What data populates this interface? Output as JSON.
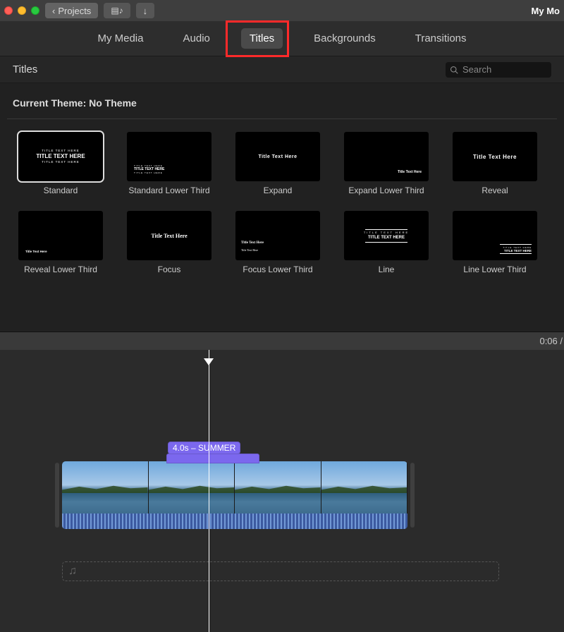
{
  "toolbar": {
    "back_label": "Projects",
    "project_title": "My Mo"
  },
  "tabs": {
    "items": [
      {
        "label": "My Media",
        "active": false
      },
      {
        "label": "Audio",
        "active": false
      },
      {
        "label": "Titles",
        "active": true
      },
      {
        "label": "Backgrounds",
        "active": false
      },
      {
        "label": "Transitions",
        "active": false
      }
    ]
  },
  "subbar": {
    "section_label": "Titles",
    "search_placeholder": "Search"
  },
  "browser": {
    "theme_heading": "Current Theme: No Theme",
    "items": [
      {
        "label": "Standard"
      },
      {
        "label": "Standard Lower Third"
      },
      {
        "label": "Expand"
      },
      {
        "label": "Expand Lower Third"
      },
      {
        "label": "Reveal"
      },
      {
        "label": "Reveal Lower Third"
      },
      {
        "label": "Focus"
      },
      {
        "label": "Focus Lower Third"
      },
      {
        "label": "Line"
      },
      {
        "label": "Line Lower Third"
      }
    ]
  },
  "timeline": {
    "playhead_time": "0:06 /",
    "title_clip_label": "4.0s – SUMMER"
  }
}
